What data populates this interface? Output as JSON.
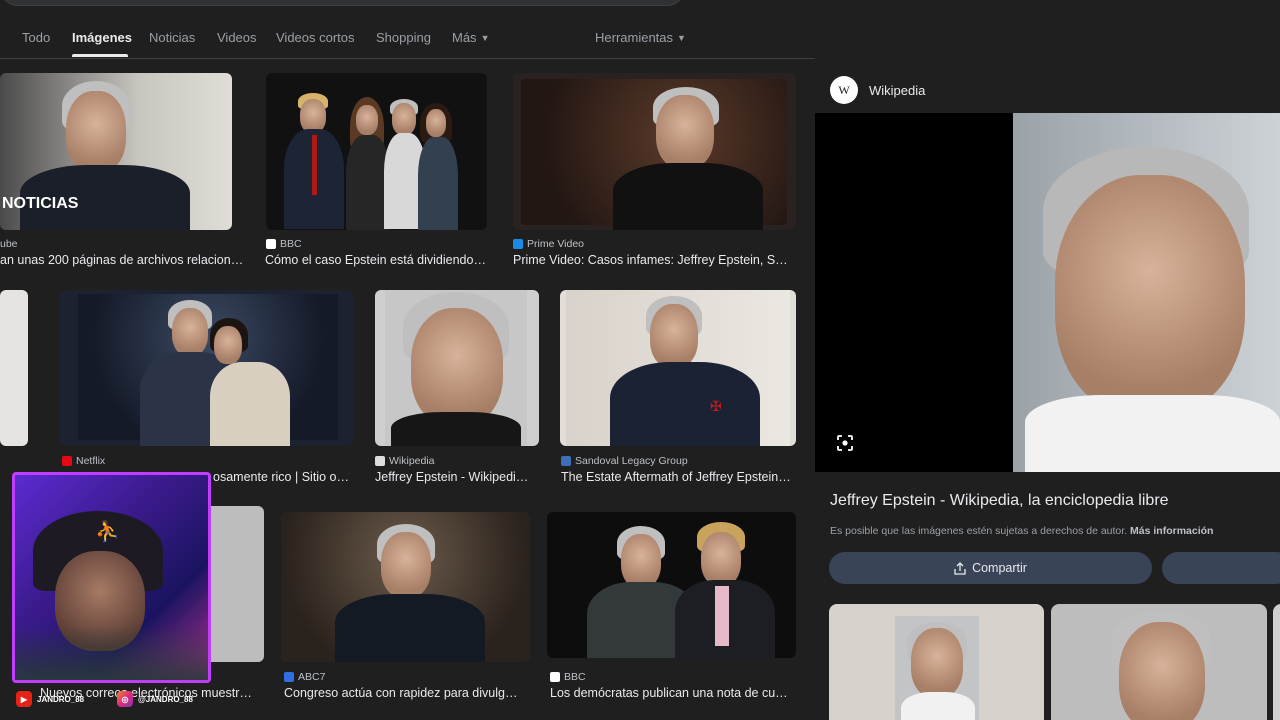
{
  "tabs": [
    {
      "label": "Todo",
      "active": false
    },
    {
      "label": "Imágenes",
      "active": true
    },
    {
      "label": "Noticias",
      "active": false
    },
    {
      "label": "Videos",
      "active": false
    },
    {
      "label": "Videos cortos",
      "active": false
    },
    {
      "label": "Shopping",
      "active": false
    },
    {
      "label": "Más",
      "active": false
    },
    {
      "label": "Herramientas",
      "active": false
    }
  ],
  "results": [
    {
      "source": "ube",
      "title": "an unas 200 páginas de archivos relacion…",
      "overlay": "NOTICIAS"
    },
    {
      "source": "BBC",
      "title": "Cómo el caso Epstein está dividiendo…"
    },
    {
      "source": "Prime Video",
      "title": "Prime Video: Casos infames: Jeffrey Epstein, S…"
    },
    {
      "source": "Netflix",
      "title": "osamente rico | Sitio o…"
    },
    {
      "source": "Wikipedia",
      "title": "Jeffrey Epstein - Wikipedi…"
    },
    {
      "source": "Sandoval Legacy Group",
      "title": "The Estate Aftermath of Jeffrey Epstein…"
    },
    {
      "source": "",
      "title": "Nuevos correos electrónicos muestr…"
    },
    {
      "source": "ABC7",
      "title": "Congreso actúa con rapidez para divulg…"
    },
    {
      "source": "BBC",
      "title": "Los demócratas publican una nota de cu…"
    }
  ],
  "panel": {
    "site": "Wikipedia",
    "logo_letter": "W",
    "title": "Jeffrey Epstein - Wikipedia, la enciclopedia libre",
    "note": "Es posible que las imágenes estén sujetas a derechos de autor.",
    "note_link": "Más información",
    "share_label": "Compartir"
  },
  "overlay": {
    "youtube_handle": "JANDRO_88",
    "instagram_handle": "@JANDRO_88"
  },
  "colors": {
    "background": "#1f1f1f",
    "accent_button": "#394457",
    "webcam_border": "#c03cff"
  },
  "icons": [
    "chevron-down-icon",
    "lens-icon",
    "share-icon",
    "youtube-icon",
    "instagram-icon"
  ]
}
